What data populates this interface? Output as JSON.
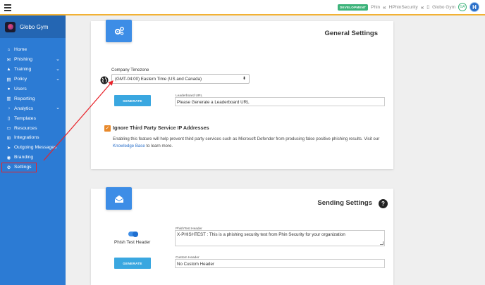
{
  "topbar": {
    "env_badge": "DEVELOPMENT",
    "breadcrumb": [
      "Phin",
      "HPhinSecurity",
      "Globo Gym"
    ],
    "small_avatar": "GA",
    "user_avatar": "H",
    "colors": {
      "accent_border": "#f2b134",
      "badge": "#3cb37a"
    }
  },
  "sidebar": {
    "brand": "Globo Gym",
    "items": [
      {
        "label": "Home",
        "icon": "home-icon",
        "glyph": "⌂"
      },
      {
        "label": "Phishing",
        "icon": "fish-icon",
        "glyph": "✉",
        "expandable": true
      },
      {
        "label": "Training",
        "icon": "graduation-cap-icon",
        "glyph": "▲",
        "expandable": true
      },
      {
        "label": "Policy",
        "icon": "document-icon",
        "glyph": "▤",
        "expandable": true
      },
      {
        "label": "Users",
        "icon": "users-icon",
        "glyph": "●"
      },
      {
        "label": "Reporting",
        "icon": "chart-icon",
        "glyph": "▥"
      },
      {
        "label": "Analytics",
        "icon": "pie-chart-icon",
        "glyph": "◔",
        "expandable": true
      },
      {
        "label": "Templates",
        "icon": "file-icon",
        "glyph": "▯"
      },
      {
        "label": "Resources",
        "icon": "folder-icon",
        "glyph": "▭"
      },
      {
        "label": "Integrations",
        "icon": "plug-icon",
        "glyph": "⊞"
      },
      {
        "label": "Outgoing Messages",
        "icon": "send-icon",
        "glyph": "➤"
      },
      {
        "label": "Branding",
        "icon": "palette-icon",
        "glyph": "◉"
      },
      {
        "label": "Settings",
        "icon": "gear-icon",
        "glyph": "⚙",
        "active": true
      }
    ],
    "colors": {
      "background": "#2c7bd4",
      "brand_bar": "#2466b3",
      "highlight": "#e8232a"
    }
  },
  "general": {
    "title": "General Settings",
    "timezone_label": "Company Timezone",
    "timezone_value": "(GMT-04:00) Eastern Time (US and Canada)",
    "generate_label": "GENERATE",
    "leaderboard_label": "Leaderboard URL",
    "leaderboard_value": "Please Generate a Leaderboard URL",
    "ignore_label": "Ignore Third Party Service IP Addresses",
    "ignore_checked": true,
    "description": "Enabling this feature will help prevent third party services such as Microsoft Defender from producing false positive phishing results. Visit our ",
    "kb_link": "Knowledge Base",
    "description_end": " to learn more."
  },
  "sending": {
    "title": "Sending Settings",
    "help": "?",
    "toggle_label": "Phish Test Header",
    "toggle_on": true,
    "header_label": "PhishTest Header",
    "header_value": "X-PHISHTEST : This is a phishing security test from Phin Security for your organization",
    "generate_label": "GENERATE",
    "custom_label": "Custom Header",
    "custom_value": "No Custom Header"
  }
}
